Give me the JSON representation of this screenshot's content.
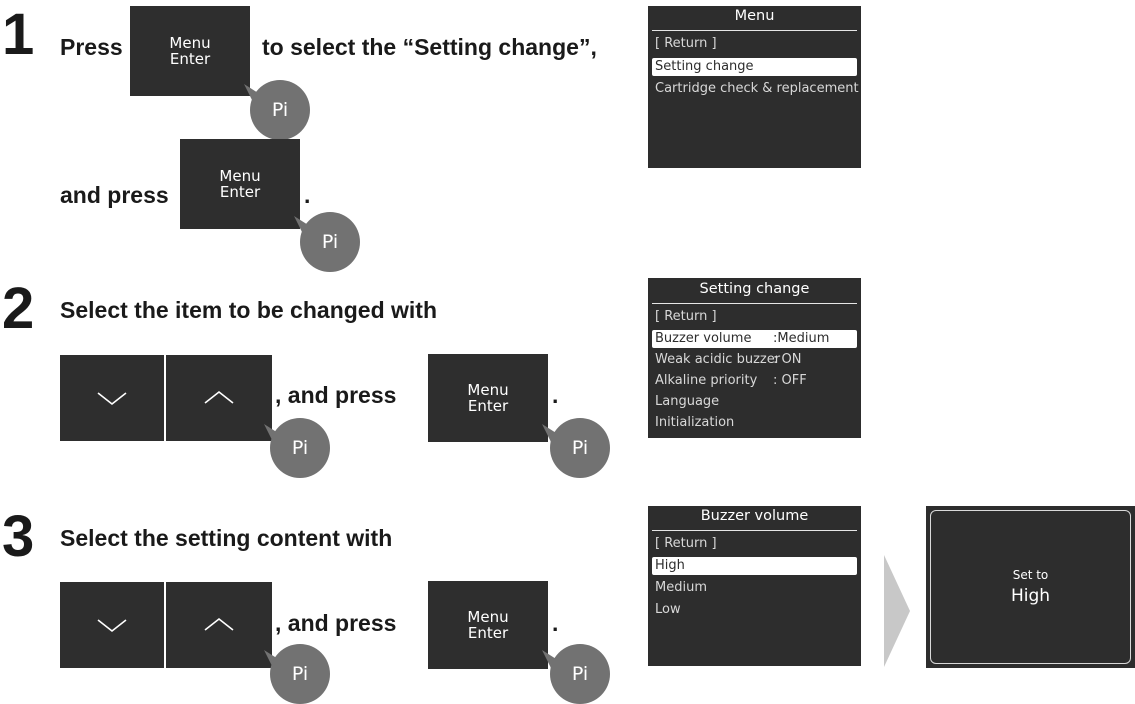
{
  "steps": {
    "s1": {
      "number": "1",
      "text_a": "Press",
      "text_b": "to select the “Setting change”,",
      "text_c": "and press",
      "text_d": "."
    },
    "s2": {
      "number": "2",
      "text_a": "Select the item to be changed with",
      "text_b": ", and press",
      "text_c": "."
    },
    "s3": {
      "number": "3",
      "text_a": "Select the setting content with",
      "text_b": ", and press",
      "text_c": "."
    }
  },
  "menu_button": {
    "line1": "Menu",
    "line2": "Enter"
  },
  "beep_label": "Pi",
  "screens": {
    "menu": {
      "title": "Menu",
      "items": [
        "[ Return ]",
        "Setting change",
        "Cartridge check & replacement"
      ],
      "selected_index": 1
    },
    "setting_change": {
      "title": "Setting change",
      "items": [
        {
          "label": "[ Return ]",
          "value": ""
        },
        {
          "label": "Buzzer volume",
          "value": ":Medium"
        },
        {
          "label": "Weak acidic buzzer",
          "value": ":   ON"
        },
        {
          "label": "Alkaline priority",
          "value": ":   OFF"
        },
        {
          "label": "Language",
          "value": ""
        },
        {
          "label": "Initialization",
          "value": ""
        }
      ],
      "selected_index": 1
    },
    "buzzer_volume": {
      "title": "Buzzer volume",
      "items": [
        "[ Return ]",
        "High",
        "Medium",
        "Low"
      ],
      "selected_index": 1
    },
    "confirm": {
      "line1": "Set to",
      "line2": "High"
    }
  },
  "icons": {
    "down": "chevron-down-icon",
    "up": "chevron-up-icon",
    "next": "chevron-right-icon"
  },
  "colors": {
    "screen_bg": "#2d2d2d",
    "button_bg": "#2e2e2e",
    "beep_bubble": "#727272",
    "next_arrow": "#c8c8c8"
  }
}
